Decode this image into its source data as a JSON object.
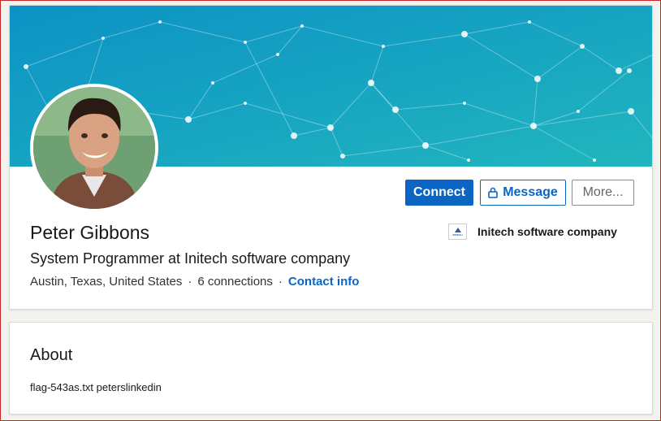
{
  "profile": {
    "name": "Peter Gibbons",
    "headline": "System Programmer at Initech software company",
    "location": "Austin, Texas, United States",
    "separator": "·",
    "connections": "6 connections",
    "contact_info": "Contact info",
    "avatar_icon": "profile-photo"
  },
  "actions": {
    "connect_label": "Connect",
    "message_label": "Message",
    "message_icon": "lock-icon",
    "more_label": "More..."
  },
  "company": {
    "name": "Initech software company",
    "logo_text": "INITECH"
  },
  "about": {
    "title": "About",
    "text": "flag-543as.txt peterslinkedin"
  },
  "colors": {
    "banner_start": "#0d93c2",
    "banner_end": "#1ab1c0",
    "accent": "#0a66c2",
    "window_border": "#c62828"
  }
}
